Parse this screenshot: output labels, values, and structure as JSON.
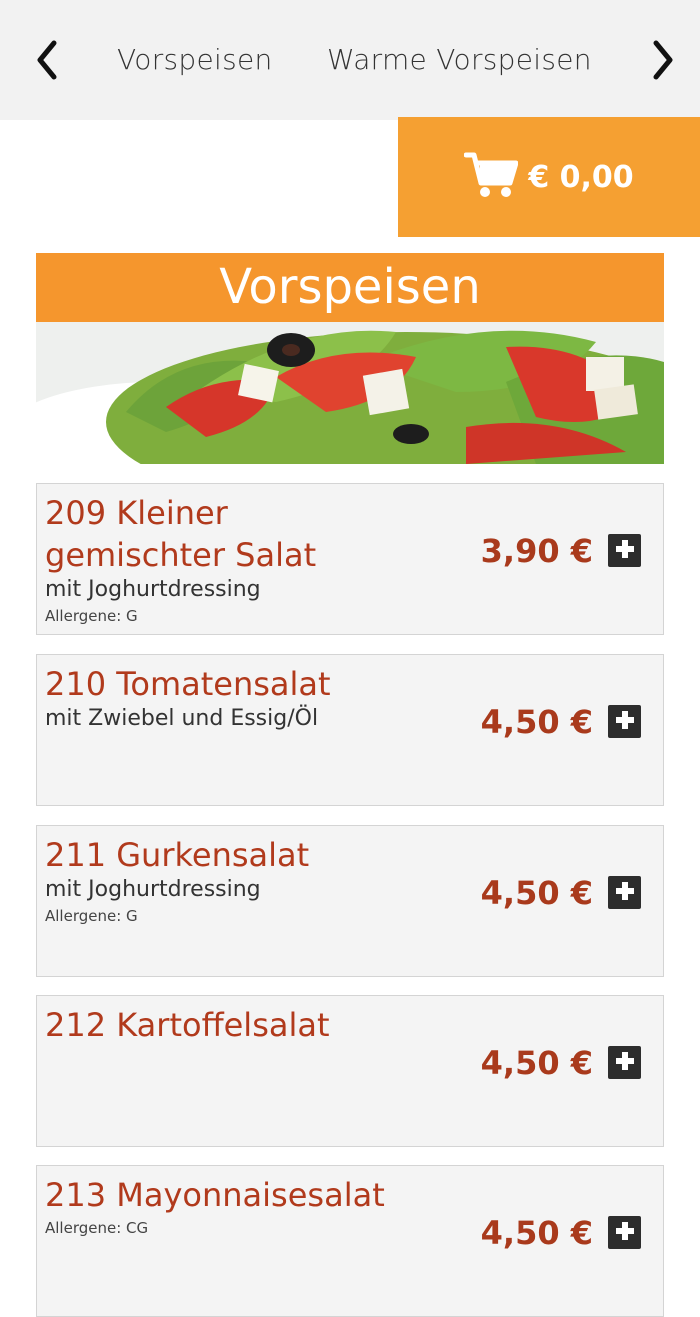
{
  "nav": {
    "categories": [
      "Vorspeisen",
      "Warme Vorspeisen"
    ]
  },
  "cart": {
    "total": "€ 0,00"
  },
  "section": {
    "title": "Vorspeisen",
    "image_alt": "salad-image"
  },
  "items": [
    {
      "name_line1": "209 Kleiner",
      "name_line2": "gemischter Salat",
      "description": "mit Joghurtdressing",
      "allergens": "Allergene: G",
      "price": "3,90 €"
    },
    {
      "name": "210 Tomatensalat",
      "description": "mit Zwiebel und Essig/Öl",
      "price": "4,50 €"
    },
    {
      "name": "211 Gurkensalat",
      "description": "mit Joghurtdressing",
      "allergens": "Allergene: G",
      "price": "4,50 €"
    },
    {
      "name": "212 Kartoffelsalat",
      "price": "4,50 €"
    },
    {
      "name": "213 Mayonnaisesalat",
      "allergens": "Allergene: CG",
      "price": "4,50 €"
    }
  ],
  "colors": {
    "accent": "#f5a032",
    "header": "#f5962d",
    "item_title": "#b13a1c",
    "price": "#a93a1c"
  }
}
